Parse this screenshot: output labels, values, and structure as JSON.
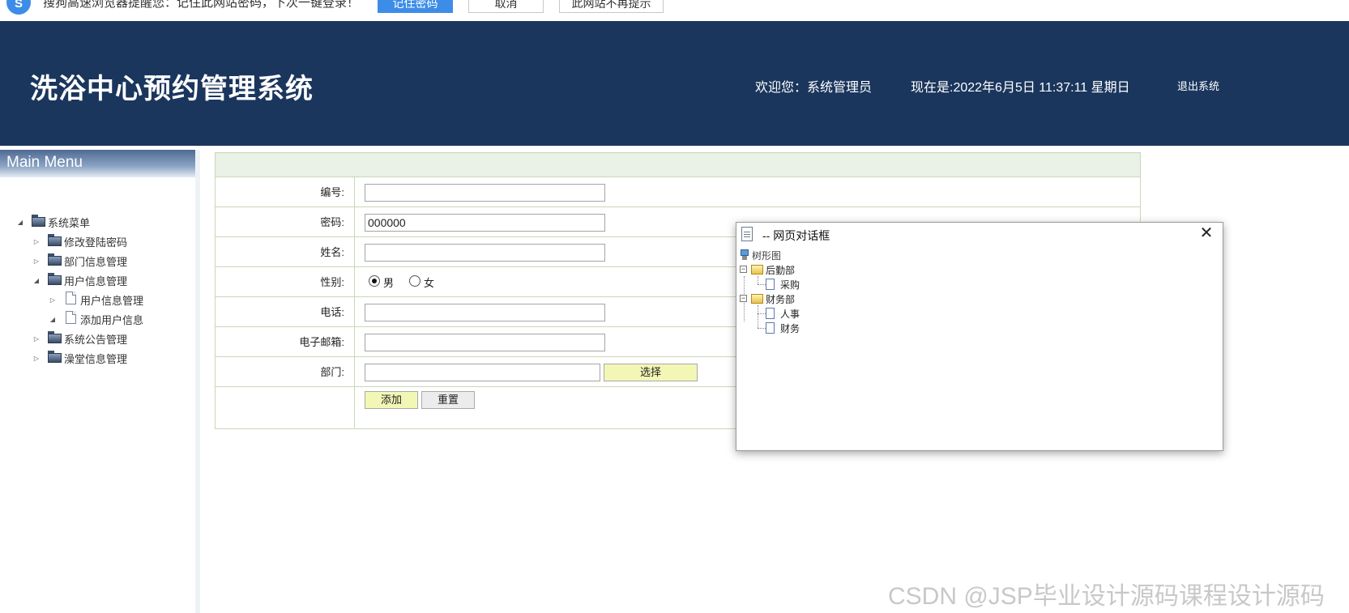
{
  "browser_prompt": {
    "icon": "sogou-logo-icon",
    "text": "搜狗高速浏览器提醒您：记住此网站密码，下次一键登录！",
    "remember_label": "记住密码",
    "cancel_label": "取消",
    "never_label": "此网站不再提示"
  },
  "header": {
    "title": "洗浴中心预约管理系统",
    "welcome": "欢迎您：系统管理员",
    "datetime": "现在是:2022年6月5日 11:37:11 星期日",
    "logout": "退出系统",
    "bg_color": "#1b365d"
  },
  "sidebar": {
    "title": "Main Menu",
    "root": "系统菜单",
    "items": [
      {
        "label": "修改登陆密码"
      },
      {
        "label": "部门信息管理"
      },
      {
        "label": "用户信息管理",
        "children": [
          {
            "label": "用户信息管理"
          },
          {
            "label": "添加用户信息"
          }
        ]
      },
      {
        "label": "系统公告管理"
      },
      {
        "label": "澡堂信息管理"
      }
    ]
  },
  "form": {
    "fields": {
      "id_label": "编号:",
      "id_value": "",
      "password_label": "密码:",
      "password_value": "000000",
      "name_label": "姓名:",
      "name_value": "",
      "gender_label": "性别:",
      "gender_male": "男",
      "gender_female": "女",
      "gender_selected": "男",
      "phone_label": "电话:",
      "phone_value": "",
      "email_label": "电子邮箱:",
      "email_value": "",
      "dept_label": "部门:",
      "dept_value": ""
    },
    "select_label": "选择",
    "add_label": "添加",
    "reset_label": "重置"
  },
  "dialog": {
    "title": "-- 网页对话框",
    "close": "✕",
    "tree": {
      "root": "树形图",
      "groups": [
        {
          "label": "后勤部",
          "children": [
            "采购"
          ]
        },
        {
          "label": "财务部",
          "children": [
            "人事",
            "财务"
          ]
        }
      ]
    }
  },
  "watermark": "CSDN @JSP毕业设计源码课程设计源码"
}
